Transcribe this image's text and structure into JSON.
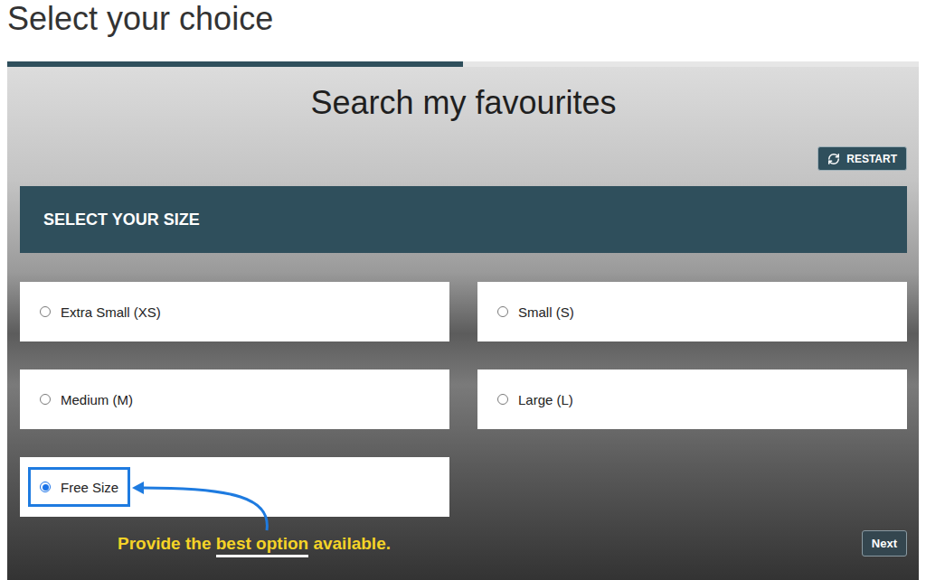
{
  "page": {
    "heading": "Select your choice"
  },
  "progress": {
    "level": 0.5
  },
  "panel": {
    "title": "Search my favourites"
  },
  "restart_button": {
    "label": "RESTART"
  },
  "section": {
    "title": "SELECT YOUR SIZE"
  },
  "options": [
    {
      "label": "Extra Small (XS)",
      "selected": false,
      "highlighted": false
    },
    {
      "label": "Small (S)",
      "selected": false,
      "highlighted": false
    },
    {
      "label": "Medium (M)",
      "selected": false,
      "highlighted": false
    },
    {
      "label": "Large (L)",
      "selected": false,
      "highlighted": false
    },
    {
      "label": "Free Size",
      "selected": true,
      "highlighted": true
    }
  ],
  "annotation": {
    "parts": [
      {
        "text": "Provide the ",
        "underlined": false
      },
      {
        "text": "best option",
        "underlined": true
      },
      {
        "text": " available.",
        "underlined": false
      }
    ]
  },
  "buttons": [
    "Next"
  ]
}
